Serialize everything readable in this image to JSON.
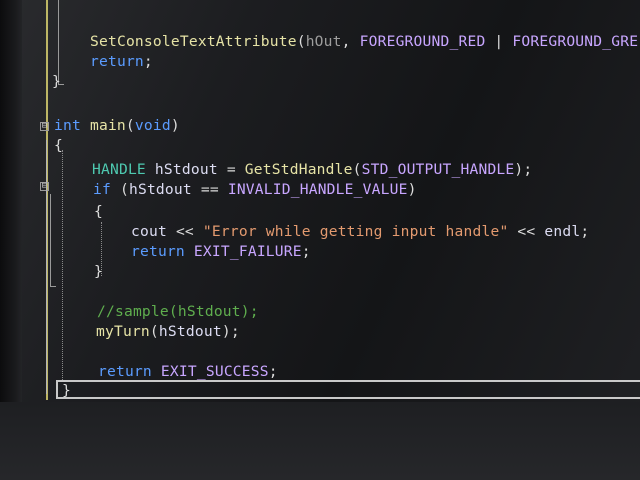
{
  "editor": {
    "lines": [
      {
        "id": "l1",
        "tokens": [
          {
            "t": "SetConsoleTextAttribute",
            "c": "fn"
          },
          {
            "t": "(",
            "c": "op"
          },
          {
            "t": "hOut",
            "c": "dim"
          },
          {
            "t": ", ",
            "c": "op"
          },
          {
            "t": "FOREGROUND_RED",
            "c": "mac"
          },
          {
            "t": " | ",
            "c": "op"
          },
          {
            "t": "FOREGROUND_GRE",
            "c": "mac"
          }
        ]
      },
      {
        "id": "l2",
        "tokens": [
          {
            "t": "return",
            "c": "kw"
          },
          {
            "t": ";",
            "c": "op"
          }
        ]
      },
      {
        "id": "l3",
        "tokens": [
          {
            "t": "}",
            "c": "op"
          }
        ]
      },
      {
        "id": "l4",
        "tokens": [
          {
            "t": "int",
            "c": "kw"
          },
          {
            "t": " ",
            "c": "op"
          },
          {
            "t": "main",
            "c": "fn"
          },
          {
            "t": "(",
            "c": "op"
          },
          {
            "t": "void",
            "c": "kw"
          },
          {
            "t": ")",
            "c": "op"
          }
        ]
      },
      {
        "id": "l5",
        "tokens": [
          {
            "t": "{",
            "c": "op"
          }
        ]
      },
      {
        "id": "l6",
        "tokens": [
          {
            "t": "HANDLE",
            "c": "ty"
          },
          {
            "t": " ",
            "c": "op"
          },
          {
            "t": "hStdout",
            "c": "id"
          },
          {
            "t": " = ",
            "c": "op"
          },
          {
            "t": "GetStdHandle",
            "c": "fn"
          },
          {
            "t": "(",
            "c": "op"
          },
          {
            "t": "STD_OUTPUT_HANDLE",
            "c": "mac"
          },
          {
            "t": ");",
            "c": "op"
          }
        ]
      },
      {
        "id": "l7",
        "tokens": [
          {
            "t": "if",
            "c": "kw"
          },
          {
            "t": " (",
            "c": "op"
          },
          {
            "t": "hStdout",
            "c": "id"
          },
          {
            "t": " == ",
            "c": "op"
          },
          {
            "t": "INVALID_HANDLE_VALUE",
            "c": "mac"
          },
          {
            "t": ")",
            "c": "op"
          }
        ]
      },
      {
        "id": "l8",
        "tokens": [
          {
            "t": "{",
            "c": "op"
          }
        ]
      },
      {
        "id": "l9",
        "tokens": [
          {
            "t": "cout",
            "c": "id"
          },
          {
            "t": " << ",
            "c": "op"
          },
          {
            "t": "\"Error while getting input handle\"",
            "c": "str"
          },
          {
            "t": " << ",
            "c": "op"
          },
          {
            "t": "endl",
            "c": "id"
          },
          {
            "t": ";",
            "c": "op"
          }
        ]
      },
      {
        "id": "l10",
        "tokens": [
          {
            "t": "return",
            "c": "kw"
          },
          {
            "t": " ",
            "c": "op"
          },
          {
            "t": "EXIT_FAILURE",
            "c": "mac"
          },
          {
            "t": ";",
            "c": "op"
          }
        ]
      },
      {
        "id": "l11",
        "tokens": [
          {
            "t": "}",
            "c": "op"
          }
        ]
      },
      {
        "id": "l12",
        "tokens": [
          {
            "t": "//sample(hStdout);",
            "c": "cm"
          }
        ]
      },
      {
        "id": "l13",
        "tokens": [
          {
            "t": "myTurn",
            "c": "fn"
          },
          {
            "t": "(",
            "c": "op"
          },
          {
            "t": "hStdout",
            "c": "id"
          },
          {
            "t": ");",
            "c": "op"
          }
        ]
      },
      {
        "id": "l14",
        "tokens": [
          {
            "t": "return",
            "c": "kw"
          },
          {
            "t": " ",
            "c": "op"
          },
          {
            "t": "EXIT_SUCCESS",
            "c": "mac"
          },
          {
            "t": ";",
            "c": "op"
          }
        ]
      },
      {
        "id": "l15",
        "tokens": [
          {
            "t": "}",
            "c": "op"
          }
        ]
      }
    ]
  },
  "fold_markers": [
    "⊟",
    "⊟"
  ],
  "colors": {
    "keyword": "#5b9cff",
    "function": "#e6e3a6",
    "type": "#4ec9b0",
    "macro": "#c8a6ff",
    "string": "#e39a6f",
    "comment": "#5fae4e"
  }
}
